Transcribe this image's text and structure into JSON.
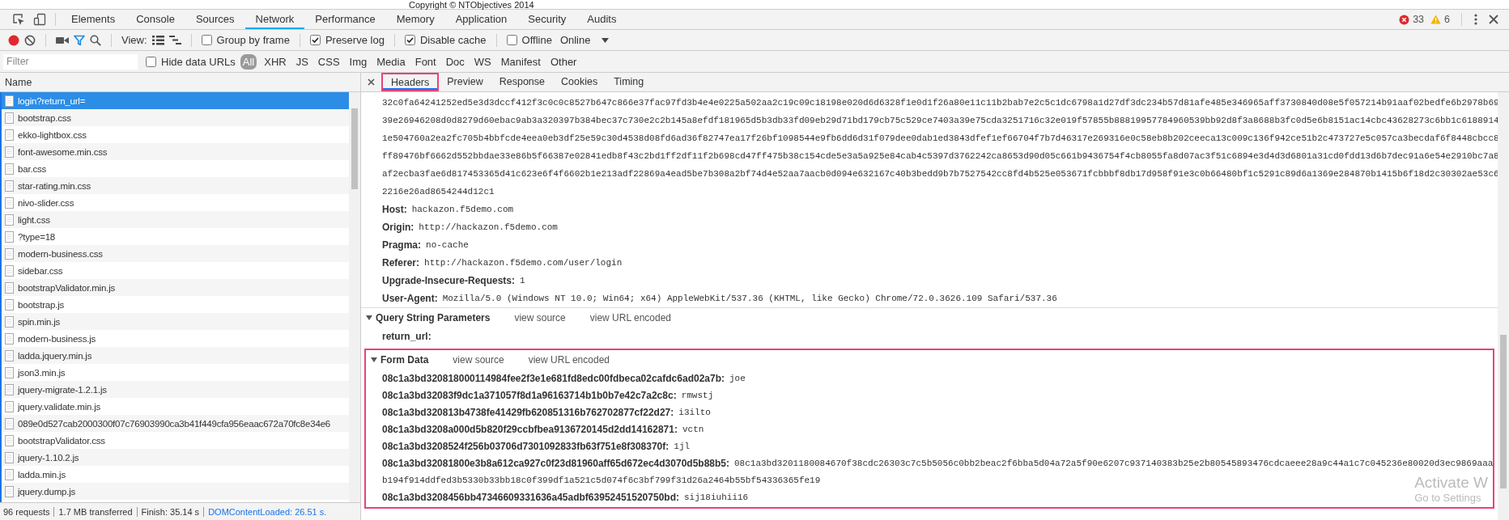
{
  "page_strip": {
    "text": "Copyright © NTObjectives 2014"
  },
  "panel_tabs": [
    {
      "label": "Elements",
      "selected": false
    },
    {
      "label": "Console",
      "selected": false
    },
    {
      "label": "Sources",
      "selected": false
    },
    {
      "label": "Network",
      "selected": true
    },
    {
      "label": "Performance",
      "selected": false
    },
    {
      "label": "Memory",
      "selected": false
    },
    {
      "label": "Application",
      "selected": false
    },
    {
      "label": "Security",
      "selected": false
    },
    {
      "label": "Audits",
      "selected": false
    }
  ],
  "console_counts": {
    "errors": "33",
    "warnings": "6"
  },
  "toolbar": {
    "recording": true,
    "view_label": "View:",
    "options": [
      {
        "label": "Group by frame",
        "checked": false
      },
      {
        "label": "Preserve log",
        "checked": true
      },
      {
        "label": "Disable cache",
        "checked": true
      },
      {
        "label": "Offline",
        "checked": false
      }
    ],
    "throttling": "Online"
  },
  "filter_bar": {
    "placeholder": "Filter",
    "hide_data_urls": {
      "label": "Hide data URLs",
      "checked": false
    },
    "types": [
      {
        "label": "All",
        "selected": true
      },
      {
        "label": "XHR",
        "selected": false
      },
      {
        "label": "JS",
        "selected": false
      },
      {
        "label": "CSS",
        "selected": false
      },
      {
        "label": "Img",
        "selected": false
      },
      {
        "label": "Media",
        "selected": false
      },
      {
        "label": "Font",
        "selected": false
      },
      {
        "label": "Doc",
        "selected": false
      },
      {
        "label": "WS",
        "selected": false
      },
      {
        "label": "Manifest",
        "selected": false
      },
      {
        "label": "Other",
        "selected": false
      }
    ]
  },
  "requests": {
    "column": "Name",
    "items": [
      {
        "name": "login?return_url=",
        "selected": true
      },
      {
        "name": "bootstrap.css",
        "selected": false
      },
      {
        "name": "ekko-lightbox.css",
        "selected": false
      },
      {
        "name": "font-awesome.min.css",
        "selected": false
      },
      {
        "name": "bar.css",
        "selected": false
      },
      {
        "name": "star-rating.min.css",
        "selected": false
      },
      {
        "name": "nivo-slider.css",
        "selected": false
      },
      {
        "name": "light.css",
        "selected": false
      },
      {
        "name": "?type=18",
        "selected": false
      },
      {
        "name": "modern-business.css",
        "selected": false
      },
      {
        "name": "sidebar.css",
        "selected": false
      },
      {
        "name": "bootstrapValidator.min.js",
        "selected": false
      },
      {
        "name": "bootstrap.js",
        "selected": false
      },
      {
        "name": "spin.min.js",
        "selected": false
      },
      {
        "name": "modern-business.js",
        "selected": false
      },
      {
        "name": "ladda.jquery.min.js",
        "selected": false
      },
      {
        "name": "json3.min.js",
        "selected": false
      },
      {
        "name": "jquery-migrate-1.2.1.js",
        "selected": false
      },
      {
        "name": "jquery.validate.min.js",
        "selected": false
      },
      {
        "name": "089e0d527cab2000300f07c76903990ca3b41f449cfa956eaac672a70fc8e34e6",
        "selected": false
      },
      {
        "name": "bootstrapValidator.css",
        "selected": false
      },
      {
        "name": "jquery-1.10.2.js",
        "selected": false
      },
      {
        "name": "ladda.min.js",
        "selected": false
      },
      {
        "name": "jquery.dump.js",
        "selected": false
      }
    ]
  },
  "status_bar": {
    "items": [
      "96 requests",
      "1.7 MB transferred",
      "Finish: 35.14 s"
    ],
    "dom_content_loaded": "DOMContentLoaded: 26.51 s."
  },
  "detail": {
    "tabs": [
      {
        "label": "Headers",
        "selected": true,
        "highlighted": true
      },
      {
        "label": "Preview",
        "selected": false,
        "highlighted": false
      },
      {
        "label": "Response",
        "selected": false,
        "highlighted": false
      },
      {
        "label": "Cookies",
        "selected": false,
        "highlighted": false
      },
      {
        "label": "Timing",
        "selected": false,
        "highlighted": false
      }
    ],
    "header_continuation": [
      "32c0fa64241252ed5e3d3dccf412f3c0c0c8527b647c866e37fac97fd3b4e4e0225a502aa2c19c09c18198e020d6d6328f1e0d1f26a80e11c11b2bab7e2c5c1dc6798a1d27df3dc234b57d81afe485e346965aff3730840d08e5f057214b91aaf02bedfe6b2978b69",
      "39e26946208d0d8279d60ebac9ab3a320397b384bec37c730e2c2b145a8efdf181965d5b3db33fd09eb29d71bd179cb75c529ce7403a39e75cda3251716c32e019f57855b88819957784960539bb92d8f3a8688b3fc0d5e6b8151ac14cbc43628273c6bb1c6188914",
      "1e504760a2ea2fc705b4bbfcde4eea0eb3df25e59c30d4538d08fd6ad36f82747ea17f26bf1098544e9fb6dd6d31f079dee0dab1ed3843dfef1ef66704f7b7d46317e269316e0c58eb8b202ceeca13c009c136f942ce51b2c473727e5c057ca3becdaf6f8448cbcc8",
      "ff89476bf6662d552bbdae33e86b5f66387e02841edb8f43c2bd1ff2df11f2b698cd47ff475b38c154cde5e3a5a925e84cab4c5397d3762242ca8653d90d05c661b9436754f4cb8055fa8d07ac3f51c6894e3d4d3d6801a31cd0fdd13d6b7dec91a6e54e2910bc7a8",
      "af2ecba3fae6d817453365d41c623e6f4f6602b1e213adf22869a4ead5be7b308a2bf74d4e52aa7aacb0d094e632167c40b3bedd9b7b7527542cc8fd4b525e053671fcbbbf8db17d958f91e3c0b66480bf1c5291c89d6a1369e284870b1415b6f18d2c30302ae53c6",
      "2216e26ad8654244d12c1"
    ],
    "headers": [
      {
        "name": "Host:",
        "value": "hackazon.f5demo.com"
      },
      {
        "name": "Origin:",
        "value": "http://hackazon.f5demo.com"
      },
      {
        "name": "Pragma:",
        "value": "no-cache"
      },
      {
        "name": "Referer:",
        "value": "http://hackazon.f5demo.com/user/login"
      },
      {
        "name": "Upgrade-Insecure-Requests:",
        "value": "1"
      },
      {
        "name": "User-Agent:",
        "value": "Mozilla/5.0 (Windows NT 10.0; Win64; x64) AppleWebKit/537.36 (KHTML, like Gecko) Chrome/72.0.3626.109 Safari/537.36"
      }
    ],
    "sections": [
      {
        "title": "Query String Parameters",
        "expanded": true,
        "highlighted": false,
        "links": [
          "view source",
          "view URL encoded"
        ],
        "params": [
          {
            "name": "return_url:"
          }
        ]
      },
      {
        "title": "Form Data",
        "expanded": true,
        "highlighted": true,
        "links": [
          "view source",
          "view URL encoded"
        ],
        "params": [
          {
            "name": "08c1a3bd320818000114984fee2f3e1e681fd8edc00fdbeca02cafdc6ad02a7b:",
            "value": "joe"
          },
          {
            "name": "08c1a3bd32083f9dc1a371057f8d1a96163714b1b0b7e42c7a2c8c:",
            "value": "rmwstj"
          },
          {
            "name": "08c1a3bd320813b4738fe41429fb620851316b762702877cf22d27:",
            "value": "i3ilto"
          },
          {
            "name": "08c1a3bd3208a000d5b820f29ccbfbea9136720145d2dd14162871:",
            "value": "vctn"
          },
          {
            "name": "08c1a3bd3208524f256b03706d7301092833fb63f751e8f308370f:",
            "value": "1jl"
          },
          {
            "name": "08c1a3bd32081800e3b8a612ca927c0f23d81960aff65d672ec4d3070d5b88b5:",
            "value": "08c1a3bd3201180084670f38cdc26303c7c5b5056c0bb2beac2f6bba5d04a72a5f90e6207c937140383b25e2b80545893476cdcaeee28a9c44a1c7c045236e80020d3ec9869aaa",
            "continuation": "b194f914ddfed3b5330b33bb18c0f399df1a521c5d074f6c3bf799f31d26a2464b55bf54336365fe19"
          },
          {
            "name": "08c1a3bd3208456bb47346609331636a45adbf63952451520750bd:",
            "value": "sij18iuhii16"
          }
        ]
      }
    ]
  },
  "os_notice": [
    "Activate W",
    "Go to Settings"
  ]
}
